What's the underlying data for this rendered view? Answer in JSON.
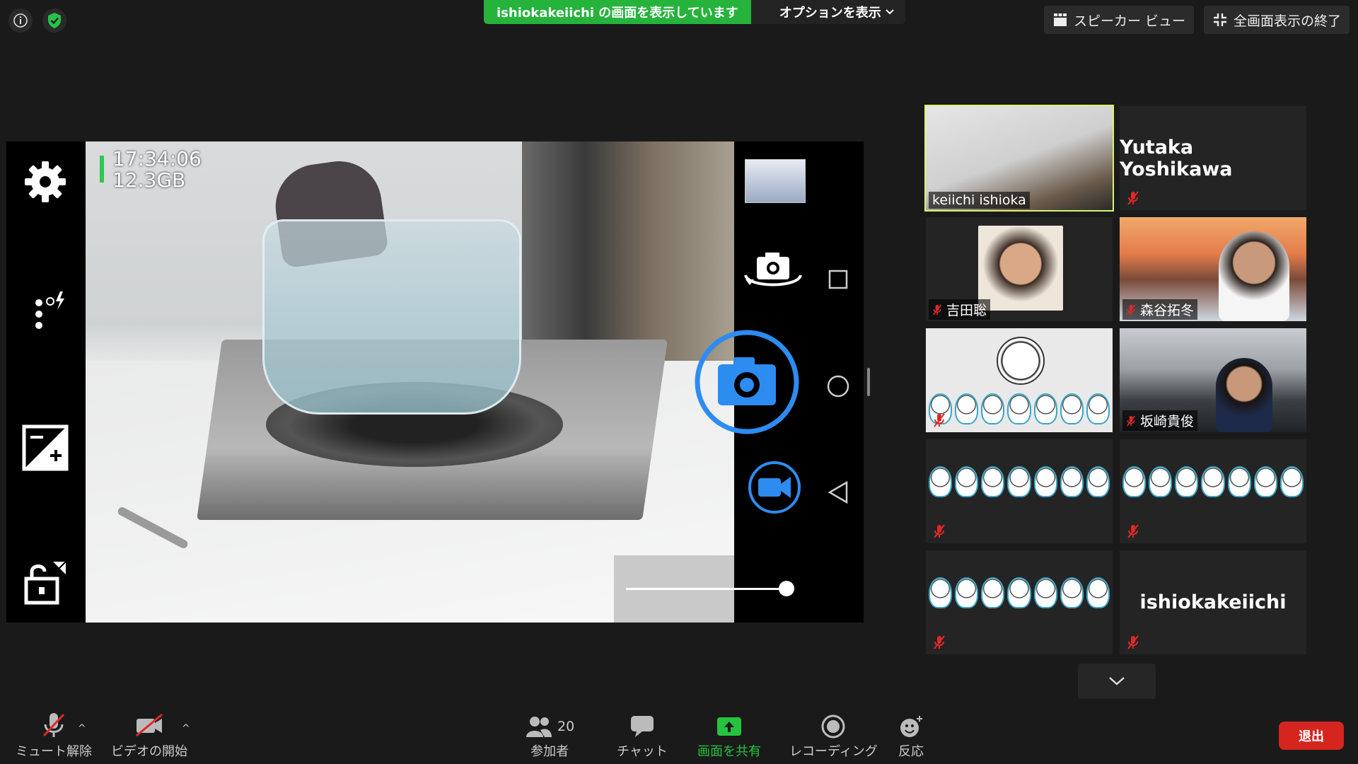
{
  "top": {
    "share_banner": "ishiokakeiichi の画面を表示しています",
    "options_label": "オプションを表示",
    "speaker_view": "スピーカー ビュー",
    "exit_fullscreen": "全画面表示の終了"
  },
  "screen": {
    "time": "17:34:06",
    "storage": "12.3GB",
    "zoom_level": 0.8
  },
  "gallery": [
    {
      "name": "keiichi ishioka",
      "active": true
    },
    {
      "name": "Yutaka Yoshikawa",
      "muted": true
    },
    {
      "name": "吉田聡",
      "muted": true
    },
    {
      "name": "森谷拓冬",
      "muted": true
    },
    {
      "name": "",
      "muted": true
    },
    {
      "name": "坂崎貴俊",
      "muted": true
    },
    {
      "name": "",
      "muted": true
    },
    {
      "name": "",
      "muted": true
    },
    {
      "name": "",
      "muted": true
    },
    {
      "name": "ishiokakeiichi",
      "muted": true
    }
  ],
  "toolbar": {
    "unmute": "ミュート解除",
    "start_video": "ビデオの開始",
    "participants": "参加者",
    "participant_count": "20",
    "chat": "チャット",
    "share": "画面を共有",
    "record": "レコーディング",
    "reactions": "反応",
    "leave": "退出"
  },
  "colors": {
    "share_green": "#25b33c",
    "active_speaker": "#d7f56b",
    "leave_red": "#d4261f",
    "shutter_blue": "#2d8cf0"
  }
}
